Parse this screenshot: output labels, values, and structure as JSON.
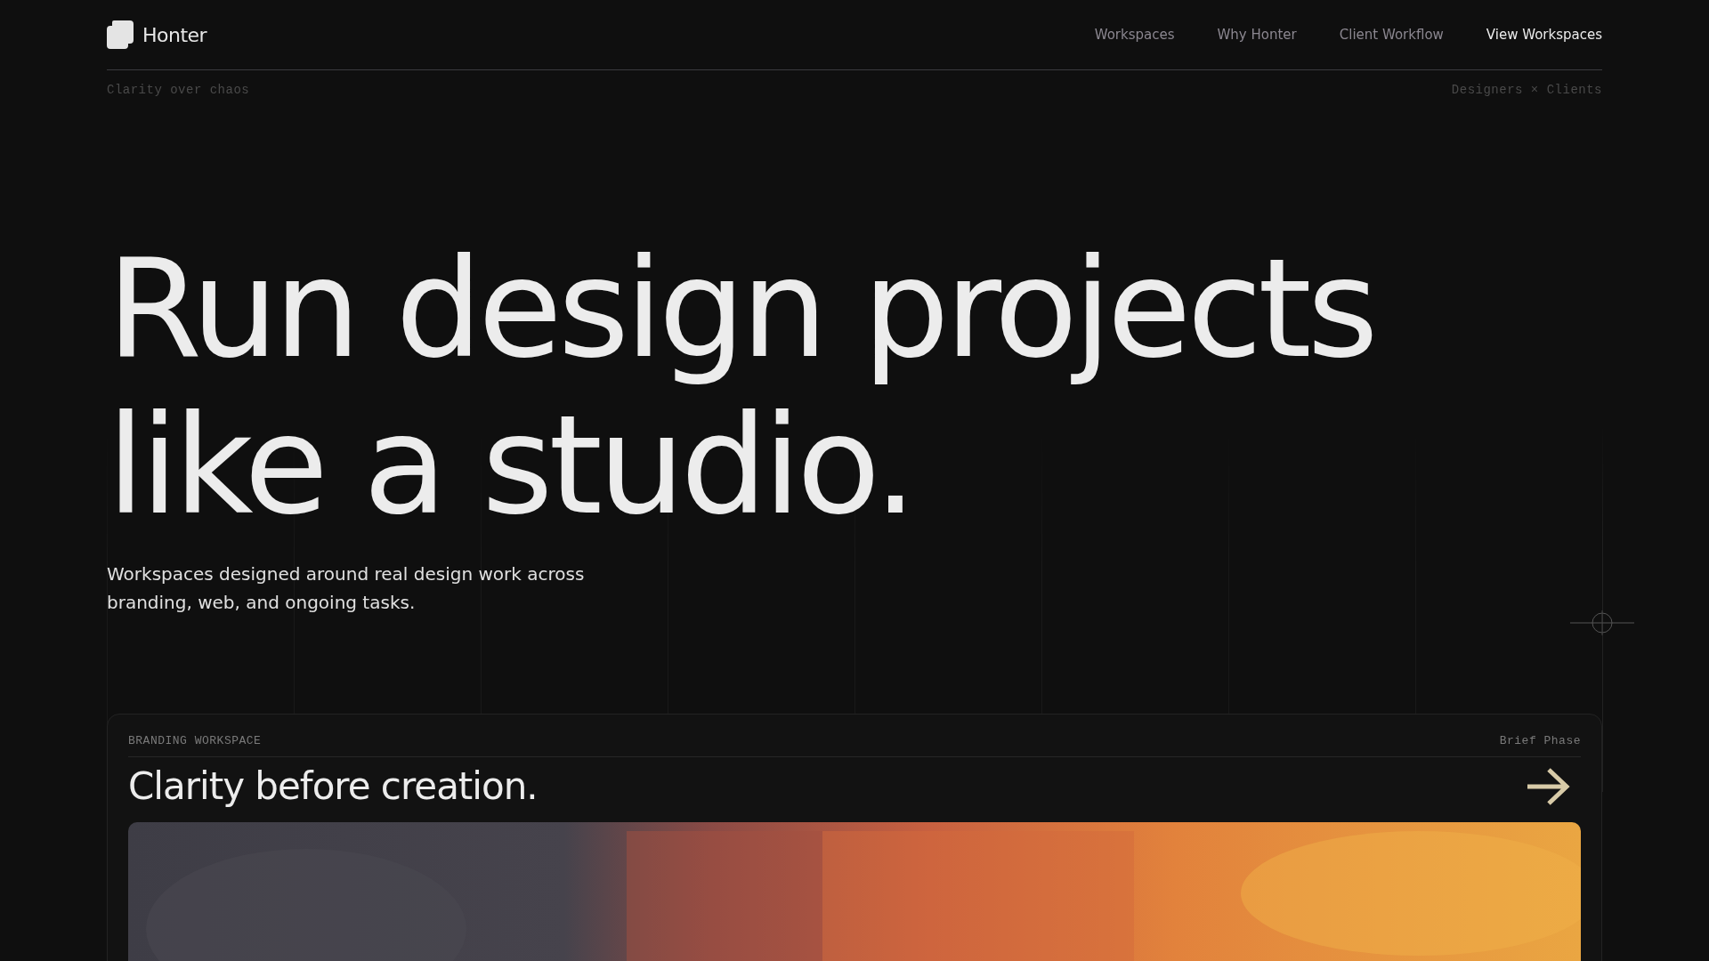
{
  "brand": {
    "name": "Honter"
  },
  "nav": [
    {
      "label": "Workspaces",
      "selected": false
    },
    {
      "label": "Why Honter",
      "selected": false
    },
    {
      "label": "Client Workflow",
      "selected": false
    },
    {
      "label": "View Workspaces",
      "selected": true
    }
  ],
  "subheader": {
    "left": "Clarity over chaos",
    "right": "Designers × Clients"
  },
  "hero": {
    "title_lines": [
      "Run design projects",
      "like a studio."
    ],
    "subtitle": "Workspaces designed around real design work across branding, web, and ongoing tasks."
  },
  "card": {
    "label": "BRANDING WORKSPACE",
    "phase": "Brief Phase",
    "title": "Clarity before creation."
  }
}
